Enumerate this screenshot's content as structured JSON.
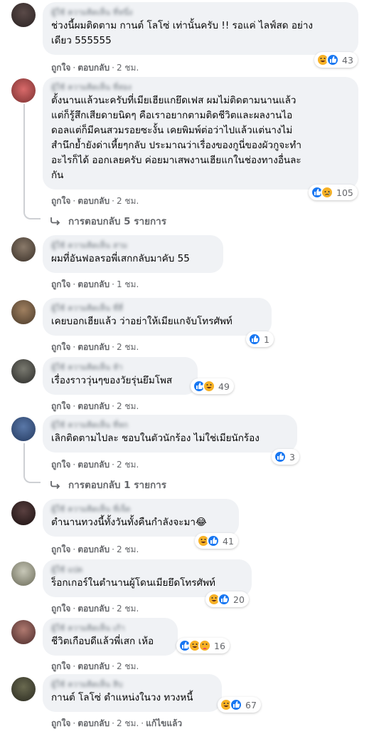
{
  "comments": [
    {
      "author": "ผู้ใช้ ความคิดเห็น ที่หนึ่ง",
      "lines": [
        "ช่วงนี้ผมติดตาม กานต์ โลโซ่ เท่านั้นครับ !! รอแค่ ไลฟ์สด อย่าง",
        "เดียว 555555"
      ],
      "reactions": {
        "icons": [
          "haha-icon",
          "like-icon"
        ],
        "count": "43"
      },
      "like": "ถูกใจ",
      "reply": "ตอบกลับ",
      "time": "2 ชม."
    },
    {
      "author": "ผู้ใช้ ความคิดเห็น ที่สอง",
      "lines": [
        "ตั้งนานแล้วนะครับที่เมียเฮียแกยึดเฟส ผมไม่ติดตามนานแล้ว",
        "แต่ก็รู้สึกเสียดายนิดๆ คือเราอยากตามติดชีวิตและผลงานไอ",
        "ดอลแต่ก็มีคนสวมรอยซะงั้น เคยพิมพ์ต่อว่าไปแล้วแต่นางไม่",
        "สำนึกย้ำยังด่าเหี้ยๆกลับ ประมาณว่าเรื่องของกูนี่ของผัวกูจะทำ",
        "อะไรก็ได้ ออกเลยครับ ค่อยมาเสพงานเฮียแกในช่องทางอื่นละ",
        "กัน"
      ],
      "reactions": {
        "icons": [
          "like-icon",
          "sad-icon"
        ],
        "count": "105"
      },
      "like": "ถูกใจ",
      "reply": "ตอบกลับ",
      "time": "2 ชม.",
      "replies_link": "การตอบกลับ 5 รายการ"
    },
    {
      "author": "ผู้ใช้ ความคิดเห็น สาม",
      "lines": [
        "ผมที่อันฟอลรอพี่เสกกลับมาคับ 55"
      ],
      "like": "ถูกใจ",
      "reply": "ตอบกลับ",
      "time": "1 ชม."
    },
    {
      "author": "ผู้ใช้ ความคิดเห็น ที่สี่",
      "lines": [
        "เคยบอกเฮียแล้ว ว่าอย่าให้เมียแกจับโทรศัพท์"
      ],
      "reactions": {
        "icons": [
          "like-icon"
        ],
        "count": "1"
      },
      "like": "ถูกใจ",
      "reply": "ตอบกลับ",
      "time": "2 ชม."
    },
    {
      "author": "ผู้ใช้ ความคิดเห็น ห้า",
      "lines": [
        "เรื่องราววุ่นๆของวัยรุ่นยึมโพส"
      ],
      "reactions": {
        "icons": [
          "like-icon",
          "haha-icon"
        ],
        "count": "49"
      },
      "like": "ถูกใจ",
      "reply": "ตอบกลับ",
      "time": "2 ชม."
    },
    {
      "author": "ผู้ใช้ ความคิดเห็น ที่หก",
      "lines": [
        "เลิกติดตามไปละ ชอบในตัวนักร้อง ไม่ใช่เมียนักร้อง"
      ],
      "reactions": {
        "icons": [
          "like-icon"
        ],
        "count": "3"
      },
      "like": "ถูกใจ",
      "reply": "ตอบกลับ",
      "time": "2 ชม.",
      "replies_link": "การตอบกลับ 1 รายการ"
    },
    {
      "author": "ผู้ใช้ ความคิดเห็น ที่เจ็ด",
      "lines": [
        "ตำนานทวงนี้ทั้งวันทั้งคืนกำลังจะมา😂"
      ],
      "reactions": {
        "icons": [
          "haha-icon",
          "like-icon"
        ],
        "count": "41"
      },
      "like": "ถูกใจ",
      "reply": "ตอบกลับ",
      "time": "2 ชม."
    },
    {
      "author": "ผู้ใช้ แปด",
      "lines": [
        "ร็อกเกอร์ในตำนานผู้โดนเมียยึดโทรศัพท์"
      ],
      "reactions": {
        "icons": [
          "haha-icon",
          "like-icon"
        ],
        "count": "20"
      },
      "like": "ถูกใจ",
      "reply": "ตอบกลับ",
      "time": "2 ชม."
    },
    {
      "author": "ผู้ใช้ ความคิดเห็น เก้า",
      "lines": [
        "ชีวิตเกือบดีแล้วพี่เสก เห้อ"
      ],
      "reactions": {
        "icons": [
          "like-icon",
          "haha-icon",
          "care-icon"
        ],
        "count": "16"
      },
      "like": "ถูกใจ",
      "reply": "ตอบกลับ",
      "time": "2 ชม."
    },
    {
      "author": "ผู้ใช้ ความคิดเห็น สิบ",
      "lines": [
        "กานต์ โลโซ่ ตำแหน่งในวง ทวงหนี้"
      ],
      "reactions": {
        "icons": [
          "haha-icon",
          "like-icon"
        ],
        "count": "67"
      },
      "like": "ถูกใจ",
      "reply": "ตอบกลับ",
      "time": "2 ชม.",
      "edited": "แก้ไขแล้ว"
    }
  ],
  "colors": {
    "bubble": "#f0f2f5",
    "meta_text": "#65676b",
    "like_blue": "#1877f2",
    "emoji_yellow": "#f7b125"
  }
}
